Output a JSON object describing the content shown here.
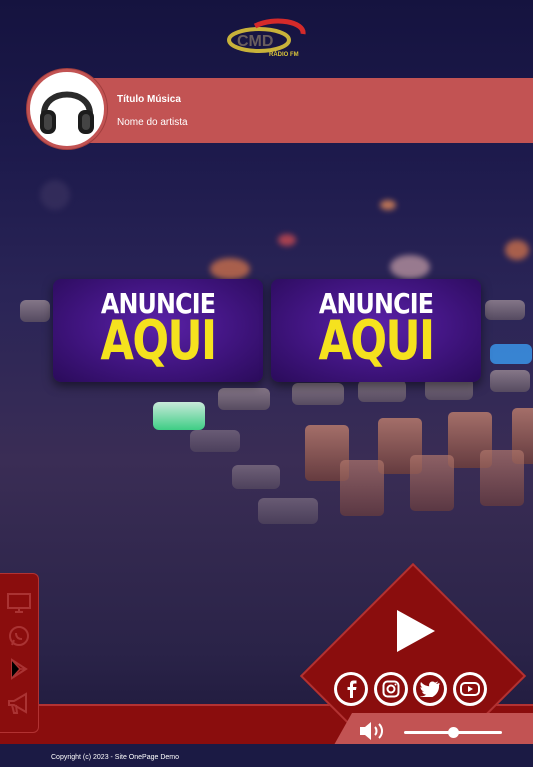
{
  "brand": {
    "logo_text": "CMD",
    "logo_sub": "RÁDIO FM"
  },
  "now_playing": {
    "title": "Título Música",
    "artist": "Nome do artista",
    "avatar_icon": "headphones-icon"
  },
  "ads": [
    {
      "line1": "ANUNCIE",
      "line2": "AQUI"
    },
    {
      "line1": "ANUNCIE",
      "line2": "AQUI"
    }
  ],
  "sidebar": {
    "items": [
      {
        "icon": "tv-icon"
      },
      {
        "icon": "whatsapp-icon"
      },
      {
        "icon": "google-play-icon"
      },
      {
        "icon": "megaphone-icon"
      }
    ]
  },
  "player": {
    "play_icon": "play-icon",
    "speaker_icon": "speaker-icon",
    "volume": 0.5
  },
  "social": [
    {
      "icon": "facebook-icon"
    },
    {
      "icon": "instagram-icon"
    },
    {
      "icon": "twitter-icon"
    },
    {
      "icon": "youtube-icon"
    }
  ],
  "footer": {
    "copyright": "Copyright (c) 2023 - Site OnePage Demo"
  },
  "colors": {
    "accent": "#c25353",
    "dark_red": "#8a0d0d",
    "background": "#1b1745",
    "ad_text": "#f5e21e"
  }
}
